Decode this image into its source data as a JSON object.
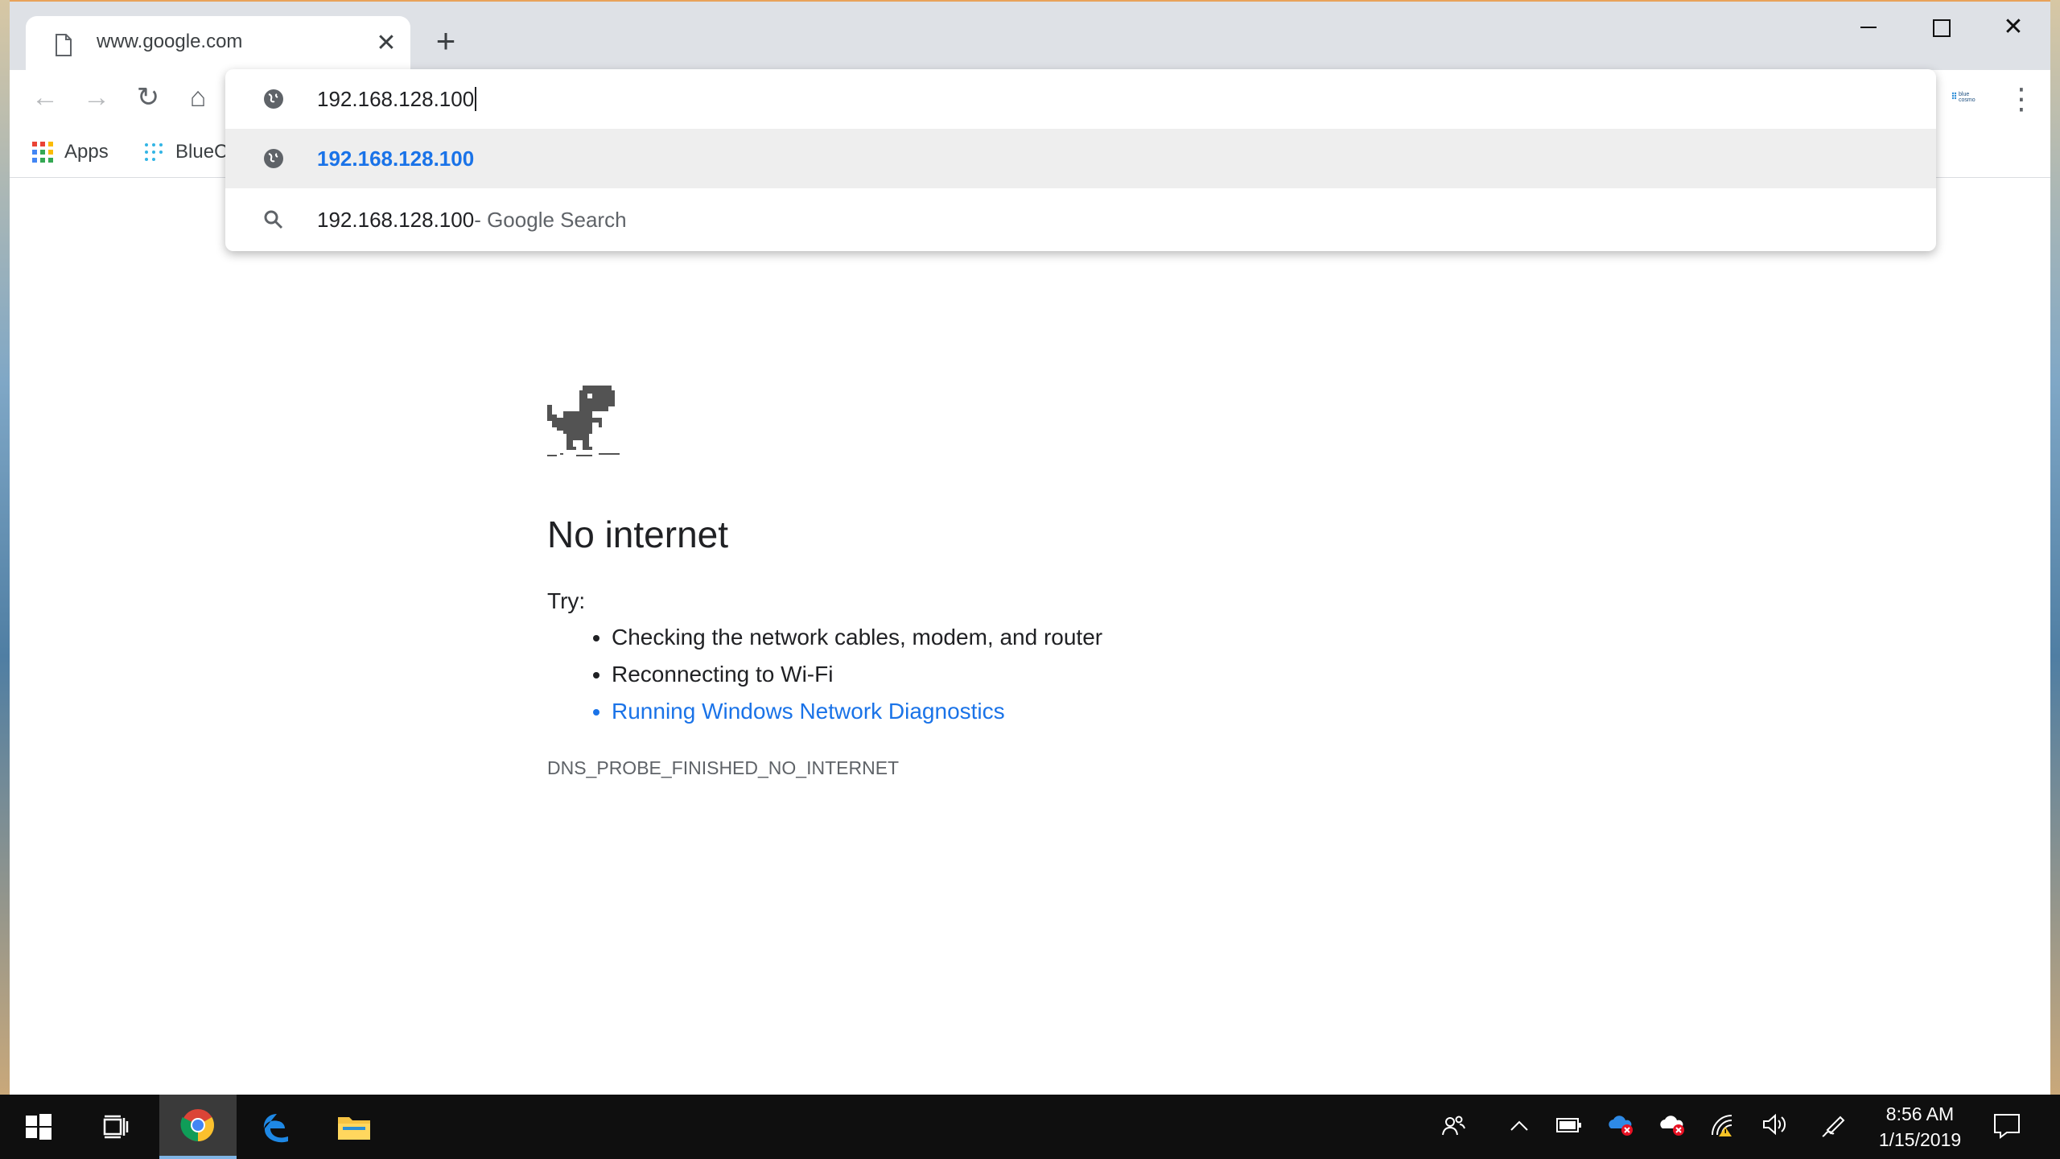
{
  "tab": {
    "title": "www.google.com",
    "close_glyph": "✕"
  },
  "new_tab_glyph": "+",
  "window_controls": {
    "minimize": "minimize",
    "maximize": "maximize",
    "close": "✕"
  },
  "toolbar": {
    "back_glyph": "←",
    "forward_glyph": "→",
    "reload_glyph": "↻",
    "home_glyph": "⌂",
    "extension_label": "blue cosmo",
    "menu_glyph": "⋮"
  },
  "bookmarks": [
    {
      "label": "Apps",
      "icon": "apps-grid-icon"
    },
    {
      "label": "BlueC",
      "icon": "bluecosmo-icon"
    }
  ],
  "omnibox": {
    "input_value": "192.168.128.100",
    "suggestions": [
      {
        "icon": "globe-icon",
        "text": "192.168.128.100",
        "sub": ""
      },
      {
        "icon": "search-icon",
        "text": "192.168.128.100",
        "sub": " - Google Search"
      }
    ]
  },
  "error_page": {
    "title": "No internet",
    "try_label": "Try:",
    "suggestions": [
      "Checking the network cables, modem, and router",
      "Reconnecting to Wi-Fi",
      "Running Windows Network Diagnostics"
    ],
    "error_code": "DNS_PROBE_FINISHED_NO_INTERNET"
  },
  "taskbar": {
    "clock_time": "8:56 AM",
    "clock_date": "1/15/2019"
  },
  "colors": {
    "accent_blue": "#1a73e8",
    "tabstrip": "#dee1e6",
    "taskbar": "#0f0f0f"
  }
}
